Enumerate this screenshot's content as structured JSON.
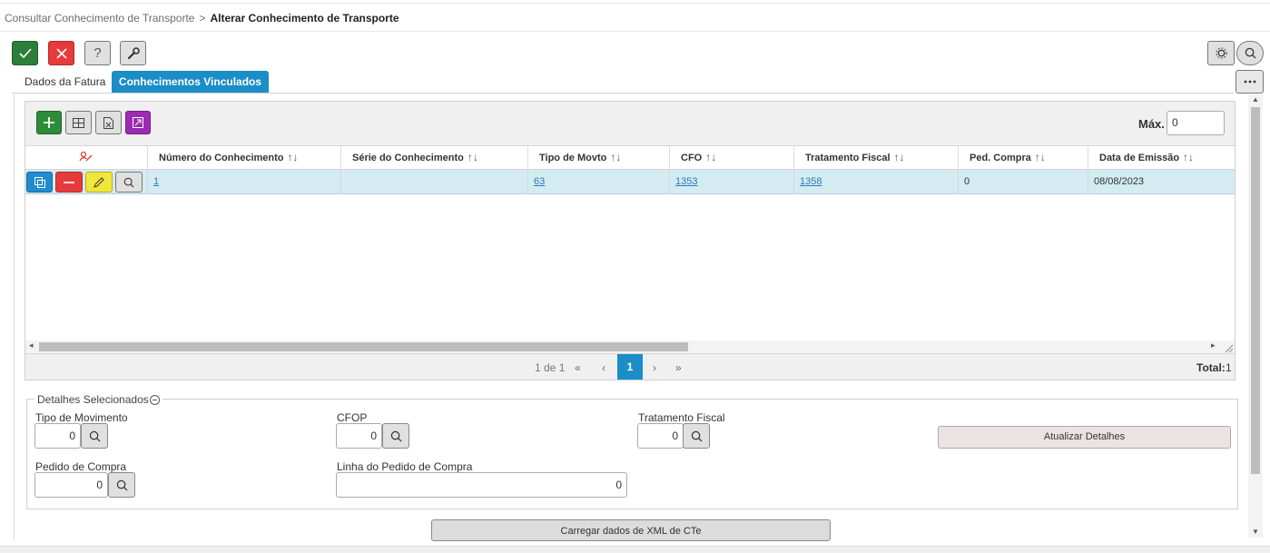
{
  "breadcrumb": {
    "parent": "Consultar Conhecimento de Transporte",
    "separator": ">",
    "current": "Alterar Conhecimento de Transporte"
  },
  "toolbar": {
    "help_glyph": "?",
    "icons": [
      "check-icon",
      "close-icon",
      "help-icon",
      "wrench-icon",
      "gear-icon",
      "search-icon",
      "more-icon"
    ]
  },
  "tabs": [
    {
      "label": "Dados da Fatura",
      "active": false
    },
    {
      "label": "Conhecimentos Vinculados",
      "active": true
    }
  ],
  "grid": {
    "max_label": "Máx.",
    "max_value": "0",
    "sort_glyph": "↑↓",
    "columns": [
      "Número do Conhecimento",
      "Série do Conhecimento",
      "Tipo de Movto",
      "CFO",
      "Tratamento Fiscal",
      "Ped. Compra",
      "Data de Emissão"
    ],
    "rows": [
      {
        "numero": "1",
        "serie": "",
        "tipo_movto": "63",
        "cfo": "1353",
        "tratamento_fiscal": "1358",
        "ped_compra": "0",
        "data_emissao": "08/08/2023"
      }
    ],
    "pager": {
      "info": "1 de 1",
      "first": "«",
      "prev": "‹",
      "current_page": "1",
      "next": "›",
      "last": "»",
      "total_label": "Total:",
      "total_value": "1"
    }
  },
  "details": {
    "legend": "Detalhes Selecionados",
    "tipo_movimento": {
      "label": "Tipo de Movimento",
      "value": "0"
    },
    "cfop": {
      "label": "CFOP",
      "value": "0"
    },
    "tratamento_fiscal": {
      "label": "Tratamento Fiscal",
      "value": "0"
    },
    "pedido_compra": {
      "label": "Pedido de Compra",
      "value": "0"
    },
    "linha_pedido": {
      "label": "Linha do Pedido de Compra",
      "value": "0"
    },
    "update_button": "Atualizar Detalhes"
  },
  "xml_button": "Carregar dados de XML de CTe",
  "colors": {
    "accent": "#1b8dc7",
    "ok": "#2d7d3b",
    "danger": "#e53b3b",
    "edit": "#f1e63a",
    "export": "#9b2bb0",
    "row_selected": "#d4ebf2"
  }
}
